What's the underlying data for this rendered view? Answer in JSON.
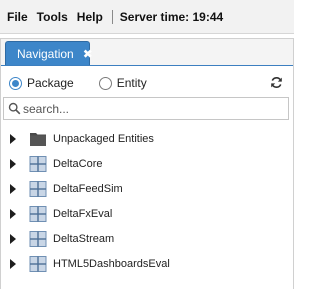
{
  "menubar": {
    "file": "File",
    "tools": "Tools",
    "help": "Help",
    "server_time": "Server time: 19:44"
  },
  "tabs": [
    {
      "label": "Navigation",
      "close_icon": "close-icon"
    }
  ],
  "view_mode": {
    "options": [
      {
        "label": "Package",
        "selected": true
      },
      {
        "label": "Entity",
        "selected": false
      }
    ],
    "refresh_icon": "refresh-icon"
  },
  "search": {
    "placeholder": "search...",
    "value": "",
    "icon": "search-icon"
  },
  "tree": {
    "items": [
      {
        "label": "Unpackaged Entities",
        "icon": "folder-icon",
        "expanded": false
      },
      {
        "label": "DeltaCore",
        "icon": "package-icon",
        "expanded": false
      },
      {
        "label": "DeltaFeedSim",
        "icon": "package-icon",
        "expanded": false
      },
      {
        "label": "DeltaFxEval",
        "icon": "package-icon",
        "expanded": false
      },
      {
        "label": "DeltaStream",
        "icon": "package-icon",
        "expanded": false
      },
      {
        "label": "HTML5DashboardsEval",
        "icon": "package-icon",
        "expanded": false
      }
    ]
  },
  "colors": {
    "accent": "#3d86c9",
    "package_icon_fill": "#c9d6e6",
    "package_icon_border": "#6f8fb3",
    "folder_icon": "#4a4a4a"
  }
}
